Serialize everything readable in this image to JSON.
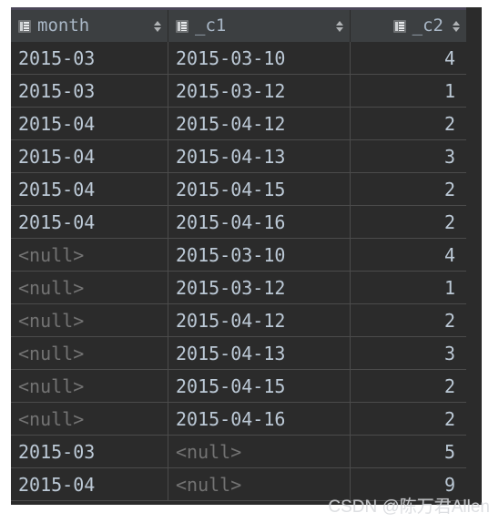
{
  "panel": {
    "accent_color": "#4a4657",
    "background_color": "#2b2b2b",
    "header_background": "#3c3f41"
  },
  "table": {
    "icons": {
      "column_icon": "table-grid-icon",
      "sort_icon": "sort-updown-icon"
    },
    "columns": [
      {
        "label": "month",
        "icon": "table-grid-icon",
        "sortable": true,
        "align": "left"
      },
      {
        "label": "_c1",
        "icon": "table-grid-icon",
        "sortable": true,
        "align": "left"
      },
      {
        "label": "_c2",
        "icon": "table-grid-icon",
        "sortable": true,
        "align": "right"
      }
    ],
    "null_text": "<null>",
    "null_color": "#737373",
    "value_color": "#bcc9d6",
    "rows": [
      {
        "month": "2015-03",
        "_c1": "2015-03-10",
        "_c2": "4"
      },
      {
        "month": "2015-03",
        "_c1": "2015-03-12",
        "_c2": "1"
      },
      {
        "month": "2015-04",
        "_c1": "2015-04-12",
        "_c2": "2"
      },
      {
        "month": "2015-04",
        "_c1": "2015-04-13",
        "_c2": "3"
      },
      {
        "month": "2015-04",
        "_c1": "2015-04-15",
        "_c2": "2"
      },
      {
        "month": "2015-04",
        "_c1": "2015-04-16",
        "_c2": "2"
      },
      {
        "month": "<null>",
        "_c1": "2015-03-10",
        "_c2": "4"
      },
      {
        "month": "<null>",
        "_c1": "2015-03-12",
        "_c2": "1"
      },
      {
        "month": "<null>",
        "_c1": "2015-04-12",
        "_c2": "2"
      },
      {
        "month": "<null>",
        "_c1": "2015-04-13",
        "_c2": "3"
      },
      {
        "month": "<null>",
        "_c1": "2015-04-15",
        "_c2": "2"
      },
      {
        "month": "<null>",
        "_c1": "2015-04-16",
        "_c2": "2"
      },
      {
        "month": "2015-03",
        "_c1": "<null>",
        "_c2": "5"
      },
      {
        "month": "2015-04",
        "_c1": "<null>",
        "_c2": "9"
      }
    ]
  },
  "watermark": {
    "text": "CSDN @陈万君Allen"
  }
}
